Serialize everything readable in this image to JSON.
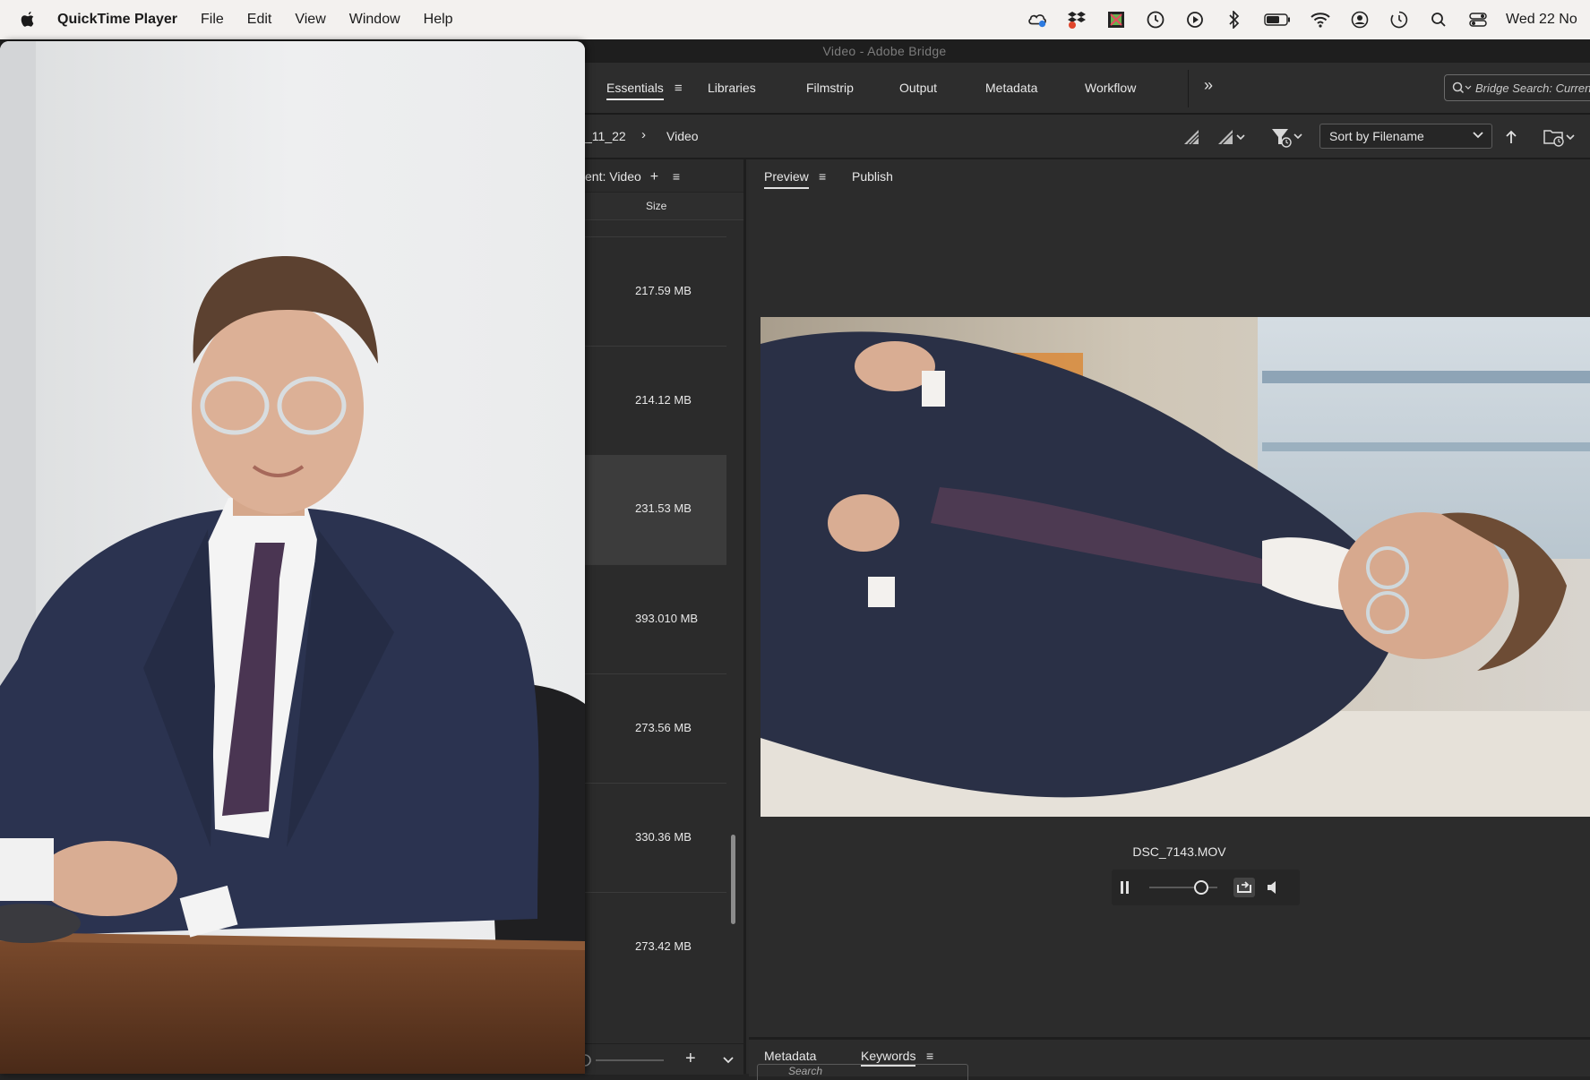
{
  "menubar": {
    "app_name": "QuickTime Player",
    "menus": [
      "File",
      "Edit",
      "View",
      "Window",
      "Help"
    ],
    "clock": "Wed 22 No",
    "tray_icons": [
      "creative-cloud-icon",
      "dropbox-icon",
      "app-icon",
      "time-machine-icon",
      "play-icon",
      "bluetooth-icon",
      "battery-icon",
      "wifi-icon",
      "user-icon",
      "screen-time-icon",
      "spotlight-icon",
      "control-center-icon"
    ]
  },
  "bridge": {
    "window_title": "Video - Adobe Bridge",
    "workspaces": [
      "Essentials",
      "Libraries",
      "Filmstrip",
      "Output",
      "Metadata",
      "Workflow"
    ],
    "search_placeholder": "Bridge Search: Curren",
    "breadcrumb": [
      "_11_22",
      "Video"
    ],
    "sort_label": "Sort by Filename",
    "content_tab": "ent: Video",
    "size_column": "Size",
    "files": [
      {
        "size": "217.59 MB",
        "selected": false
      },
      {
        "size": "214.12 MB",
        "selected": false
      },
      {
        "size": "231.53 MB",
        "selected": true
      },
      {
        "size": "393.010 MB",
        "selected": false
      },
      {
        "size": "273.56 MB",
        "selected": false
      },
      {
        "size": "330.36 MB",
        "selected": false
      },
      {
        "size": "273.42 MB",
        "selected": false
      }
    ],
    "preview_tabs": [
      "Preview",
      "Publish"
    ],
    "preview_filename": "DSC_7143.MOV",
    "bottom_tabs": [
      "Metadata",
      "Keywords"
    ],
    "keyword_search_placeholder": "Search"
  },
  "colors": {
    "bridge_bg": "#2b2b2b",
    "menubar_bg": "#f3f1ef",
    "text_light": "#e8e8e8"
  }
}
